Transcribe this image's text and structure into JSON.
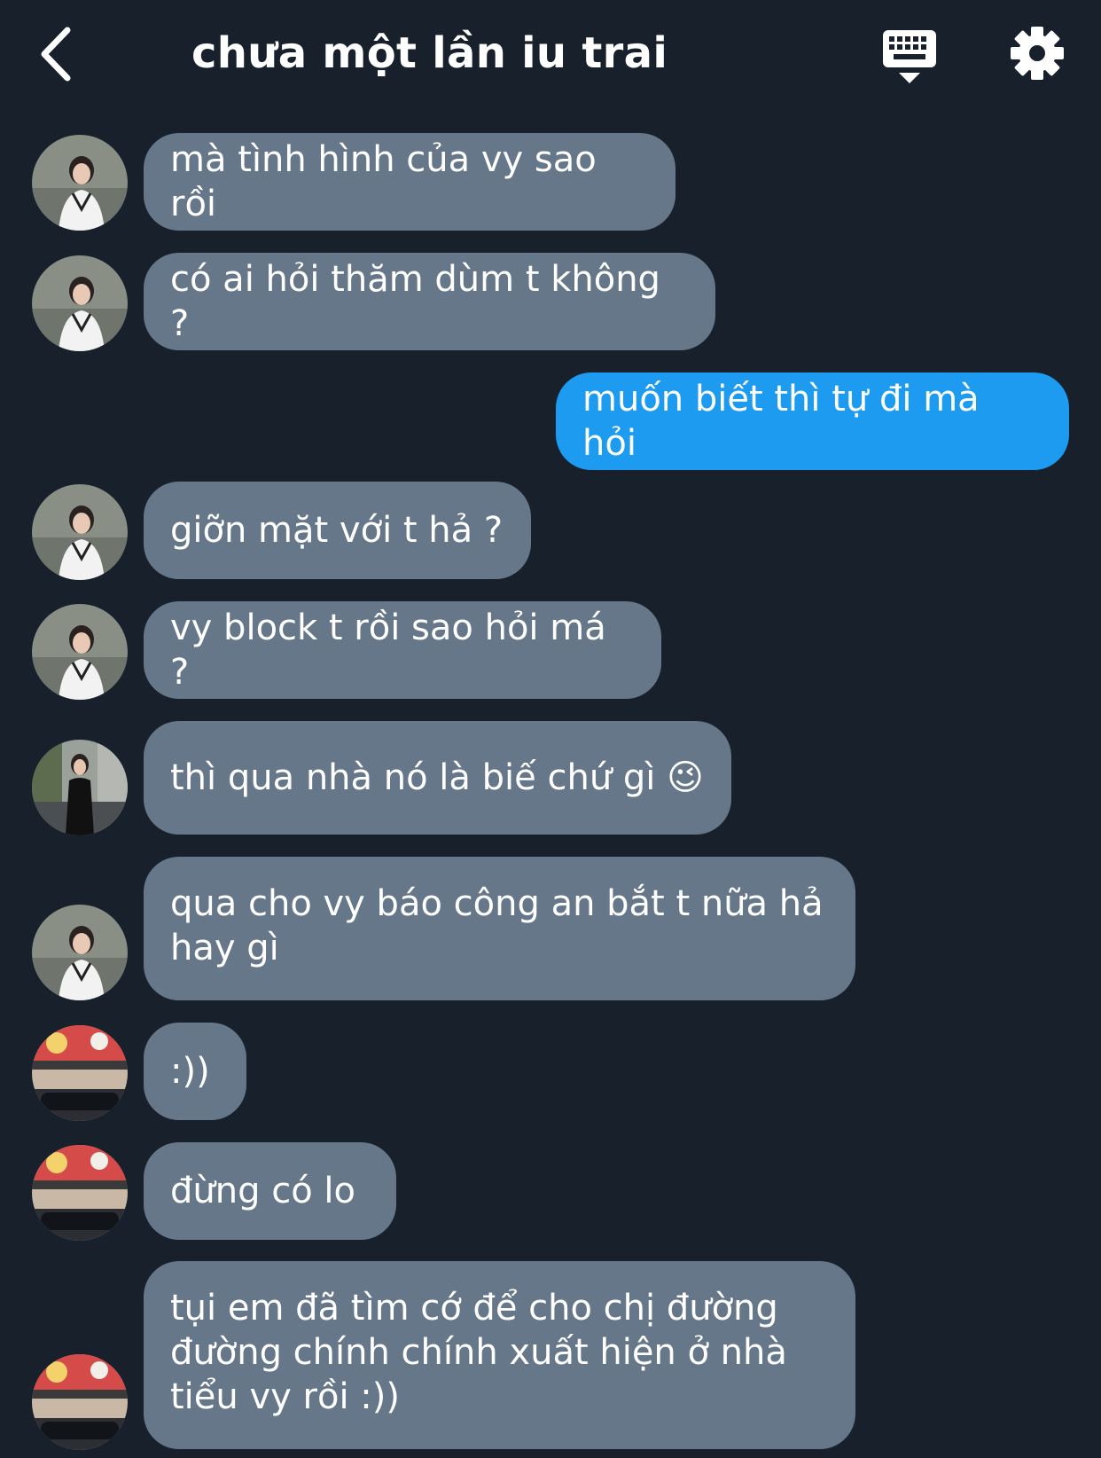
{
  "header": {
    "title": "chưa một lần iu trai",
    "back_icon": "chevron-left-icon",
    "keyboard_icon": "keyboard-icon",
    "settings_icon": "gear-icon"
  },
  "colors": {
    "background": "#17202b",
    "bubble_received": "#66778a",
    "bubble_sent": "#1d9bf0"
  },
  "messages": [
    {
      "text": "mà tình hình của vy sao rồi",
      "from": "other",
      "avatar": "avatar-a"
    },
    {
      "text": "có ai hỏi thăm dùm t không ?",
      "from": "other",
      "avatar": "avatar-a"
    },
    {
      "text": "muốn biết thì tự đi mà hỏi",
      "from": "me"
    },
    {
      "text": "giỡn mặt với t hả ?",
      "from": "other",
      "avatar": "avatar-a"
    },
    {
      "text": "vy block t rồi sao hỏi má ?",
      "from": "other",
      "avatar": "avatar-a"
    },
    {
      "text": "thì qua nhà nó là biế chứ gì 😉",
      "from": "other",
      "avatar": "avatar-b"
    },
    {
      "text": "qua cho vy báo công an bắt t nữa hả\nhay gì",
      "from": "other",
      "avatar": "avatar-a"
    },
    {
      "text": ":))",
      "from": "other",
      "avatar": "avatar-c"
    },
    {
      "text": "đừng có lo",
      "from": "other",
      "avatar": "avatar-c"
    },
    {
      "text": "tụi em đã tìm cớ để cho chị đường\nđường chính chính xuất hiện ở nhà\ntiểu vy rồi :))",
      "from": "other",
      "avatar": "avatar-c"
    }
  ]
}
